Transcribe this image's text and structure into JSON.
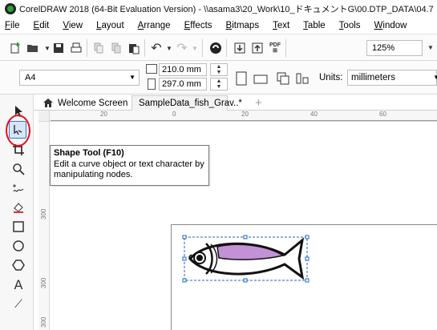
{
  "window": {
    "title": "CorelDRAW 2018 (64-Bit Evaluation Version) - \\\\asama3\\20_Work\\10_ドキュメントG\\00.DTP_DATA\\04.7"
  },
  "menu": [
    "File",
    "Edit",
    "View",
    "Layout",
    "Arrange",
    "Effects",
    "Bitmaps",
    "Text",
    "Table",
    "Tools",
    "Window"
  ],
  "toolbar": {
    "icons": [
      "new-document-icon",
      "open-icon",
      "save-icon",
      "print-icon",
      "cut-icon",
      "copy-icon",
      "paste-icon",
      "undo-icon",
      "redo-icon",
      "corel-connect-icon",
      "import-icon",
      "export-icon",
      "publish-pdf-icon"
    ],
    "zoom": "125%"
  },
  "propbar": {
    "paper": "A4",
    "width": "210.0 mm",
    "height": "297.0 mm",
    "units_label": "Units:",
    "units_value": "millimeters"
  },
  "tabs": {
    "home": "Welcome Screen",
    "doc": "SampleData_fish_Grav..*",
    "add": "+"
  },
  "ruler": {
    "h_labels": [
      "20",
      "0",
      "20",
      "40",
      "60"
    ],
    "v_labels": [
      "300",
      "300",
      "300"
    ]
  },
  "tooltip": {
    "title": "Shape Tool (F10)",
    "description": "Edit a curve object or text character by manipulating nodes."
  },
  "colors": {
    "fish_body": "#c391d6",
    "highlight_circle": "#e0121b",
    "selection": "#1f64c8"
  }
}
